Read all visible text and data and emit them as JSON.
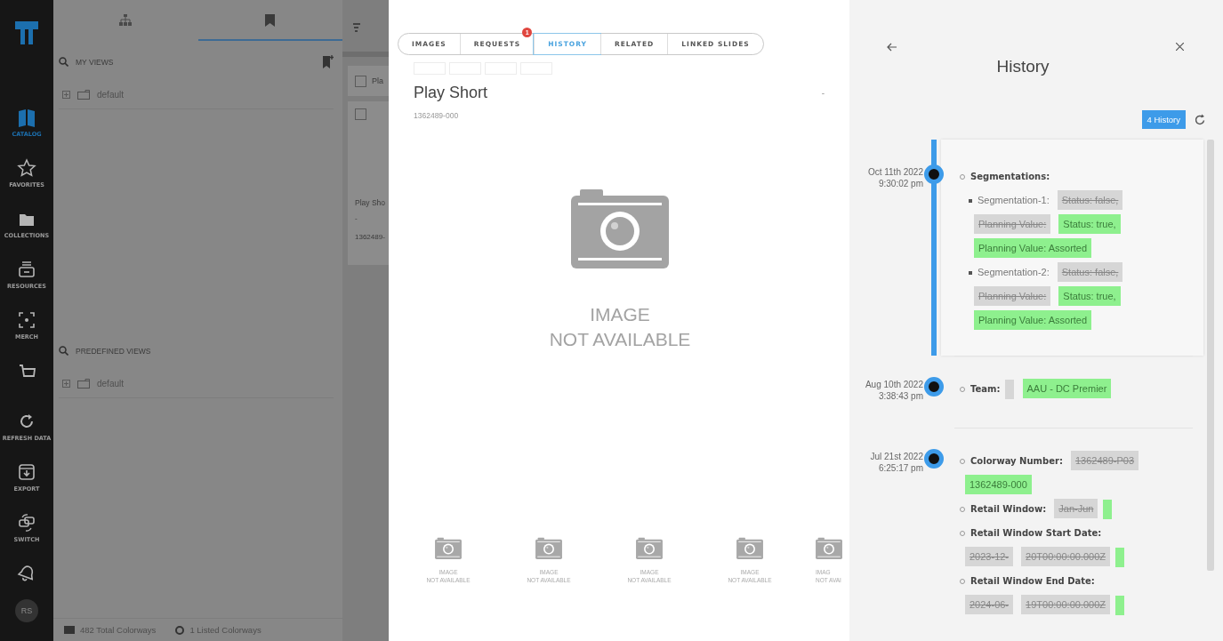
{
  "nav": {
    "items": [
      {
        "kind": "catalog",
        "label": "CATALOG",
        "selected": true
      },
      {
        "kind": "favorites",
        "label": "FAVORITES",
        "selected": false
      },
      {
        "kind": "collections",
        "label": "COLLECTIONS",
        "selected": false
      },
      {
        "kind": "resources",
        "label": "RESOURCES",
        "selected": false
      },
      {
        "kind": "merch",
        "label": "MERCH",
        "selected": false
      },
      {
        "kind": "basket",
        "selected": false
      },
      {
        "kind": "refresh",
        "label": "REFRESH DATA",
        "selected": false
      },
      {
        "kind": "export",
        "label": "EXPORT",
        "selected": false
      },
      {
        "kind": "switch",
        "label": "SWITCH",
        "selected": false
      },
      {
        "kind": "bell",
        "selected": false
      }
    ],
    "avatar": "RS"
  },
  "views": {
    "tabs": [
      {
        "kind": "hierarchy",
        "selected": false
      },
      {
        "kind": "bookmark",
        "selected": true
      }
    ],
    "sections": [
      {
        "title": "MY VIEWS",
        "items": [
          {
            "label": "default",
            "expanded": false
          }
        ]
      },
      {
        "title": "PREDEFINED VIEWS",
        "items": [
          {
            "label": "default",
            "expanded": false
          }
        ]
      }
    ]
  },
  "status_bar": {
    "items": [
      {
        "kind": "grid",
        "text": "482 Total Colorways"
      },
      {
        "kind": "list",
        "text": "1 Listed Colorways"
      }
    ]
  },
  "card_list": {
    "header": {
      "label": "Pla",
      "checked": false
    },
    "card": {
      "checked": false,
      "title": "Play Sho",
      "subtitle": "-",
      "code": "1362489-"
    }
  },
  "detail": {
    "tabs": [
      {
        "label": "IMAGES",
        "selected": false
      },
      {
        "label": "REQUESTS",
        "selected": false,
        "badge": "1"
      },
      {
        "label": "HISTORY",
        "selected": true
      },
      {
        "label": "RELATED",
        "selected": false
      },
      {
        "label": "LINKED SLIDES",
        "selected": false
      }
    ],
    "title": "Play Short",
    "code": "1362489-000",
    "side_mark": "-",
    "image": {
      "line1": "IMAGE",
      "line2": "NOT AVAILABLE"
    },
    "thumbnails": [
      {
        "line1": "IMAGE",
        "line2": "NOT AVAILABLE"
      },
      {
        "line1": "IMAGE",
        "line2": "NOT AVAILABLE"
      },
      {
        "line1": "IMAGE",
        "line2": "NOT AVAILABLE"
      },
      {
        "line1": "IMAGE",
        "line2": "NOT AVAILABLE"
      },
      {
        "line1": "IMAG",
        "line2": "NOT AVAI"
      }
    ]
  },
  "history": {
    "title": "History",
    "count_button": "4 History",
    "entries": [
      {
        "date": "Oct 11th 2022",
        "time": "9:30:02 pm",
        "changes": [
          {
            "field": "Segmentations:",
            "children": [
              {
                "field": "Segmentation-1:",
                "removed": [
                  "Status: false,",
                  "Planning Value:"
                ],
                "added": [
                  "Status: true,",
                  "Planning Value: Assorted"
                ]
              },
              {
                "field": "Segmentation-2:",
                "removed": [
                  "Status: false,",
                  "Planning Value:"
                ],
                "added": [
                  "Status: true,",
                  "Planning Value: Assorted"
                ]
              }
            ]
          }
        ]
      },
      {
        "date": "Aug 10th 2022",
        "time": "3:38:43 pm",
        "changes": [
          {
            "field": "Team:",
            "removed_blank": true,
            "added": [
              "AAU - DC Premier"
            ]
          }
        ]
      },
      {
        "date": "Jul 21st 2022",
        "time": "6:25:17 pm",
        "changes": [
          {
            "field": "Colorway Number:",
            "removed": [
              "1362489-P03"
            ],
            "added": [
              "1362489-000"
            ]
          },
          {
            "field": "Retail Window:",
            "removed": [
              "Jan-Jun"
            ],
            "added_blank": true
          },
          {
            "field": "Retail Window Start Date:",
            "removed": [
              "2023-12-",
              "20T00:00:00.000Z"
            ],
            "added_blank": true
          },
          {
            "field": "Retail Window End Date:",
            "removed": [
              "2024-06-",
              "19T00:00:00.000Z"
            ],
            "added_blank": true
          }
        ]
      }
    ]
  }
}
